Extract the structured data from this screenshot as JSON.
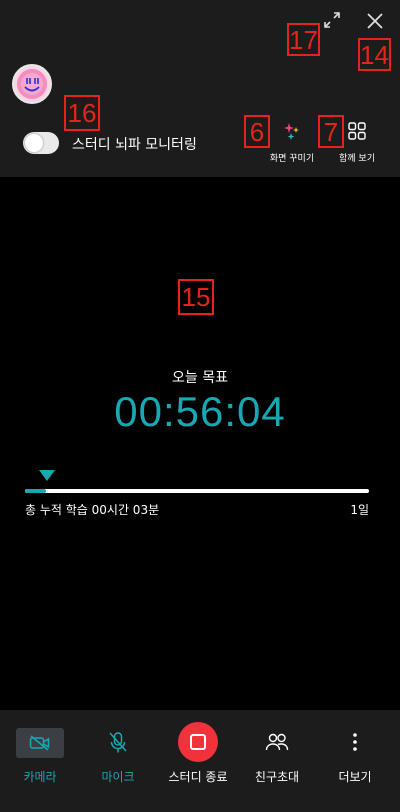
{
  "top": {
    "monitoring_label": "스터디 뇌파 모니터링",
    "monitoring_on": false,
    "decorate_label": "화면 꾸미기",
    "together_label": "함께 보기"
  },
  "badges": {
    "fullscreen": "17",
    "close": "14",
    "monitoring": "16",
    "decorate": "6",
    "together": "7",
    "main": "15"
  },
  "study": {
    "goal_label": "오늘 목표",
    "timer": "00:56:04",
    "progress_fraction": 0.06,
    "total_label": "총 누적 학습 00시간 03분",
    "day_label": "1일"
  },
  "bottom_nav": {
    "camera": "카메라",
    "mic": "마이크",
    "end_study": "스터디 종료",
    "invite": "친구초대",
    "more": "더보기"
  },
  "colors": {
    "accent": "#16a9b3",
    "end_button": "#f1313b",
    "badge": "#e5231b",
    "panel": "#1c1c1c"
  },
  "icons": [
    "expand-icon",
    "close-icon",
    "sparkle-icon",
    "grid-icon",
    "camera-off-icon",
    "mic-off-icon",
    "stop-icon",
    "friends-icon",
    "more-vertical-icon"
  ]
}
